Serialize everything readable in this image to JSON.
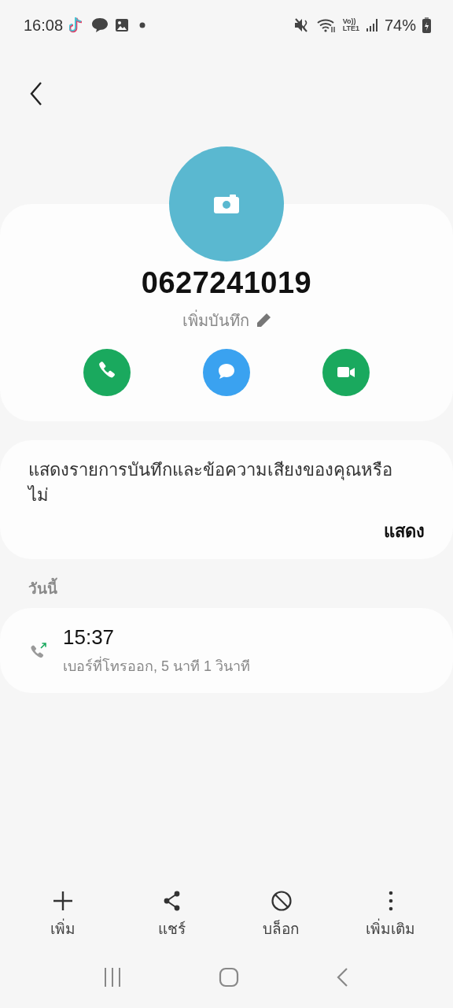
{
  "status_bar": {
    "time": "16:08",
    "network_top": "Vo))",
    "network_bottom": "LTE1",
    "battery": "74%"
  },
  "contact": {
    "number": "0627241019",
    "note_placeholder": "เพิ่มบันทึก",
    "actions": [
      {
        "kind": "call",
        "color": "#1aa95e"
      },
      {
        "kind": "message",
        "color": "#3aa2f0"
      },
      {
        "kind": "video",
        "color": "#1aa95e"
      }
    ]
  },
  "prompt": {
    "text": "แสดงรายการบันทึกและข้อความเสียงของคุณหรือไม่",
    "button": "แสดง"
  },
  "history": {
    "heading": "วันนี้",
    "calls": [
      {
        "kind": "outgoing",
        "time": "15:37",
        "detail": "เบอร์ที่โทรออก, 5 นาที 1 วินาที"
      }
    ]
  },
  "toolbar": [
    {
      "kind": "add",
      "label": "เพิ่ม"
    },
    {
      "kind": "share",
      "label": "แชร์"
    },
    {
      "kind": "block",
      "label": "บล็อก"
    },
    {
      "kind": "more",
      "label": "เพิ่มเติม"
    }
  ]
}
